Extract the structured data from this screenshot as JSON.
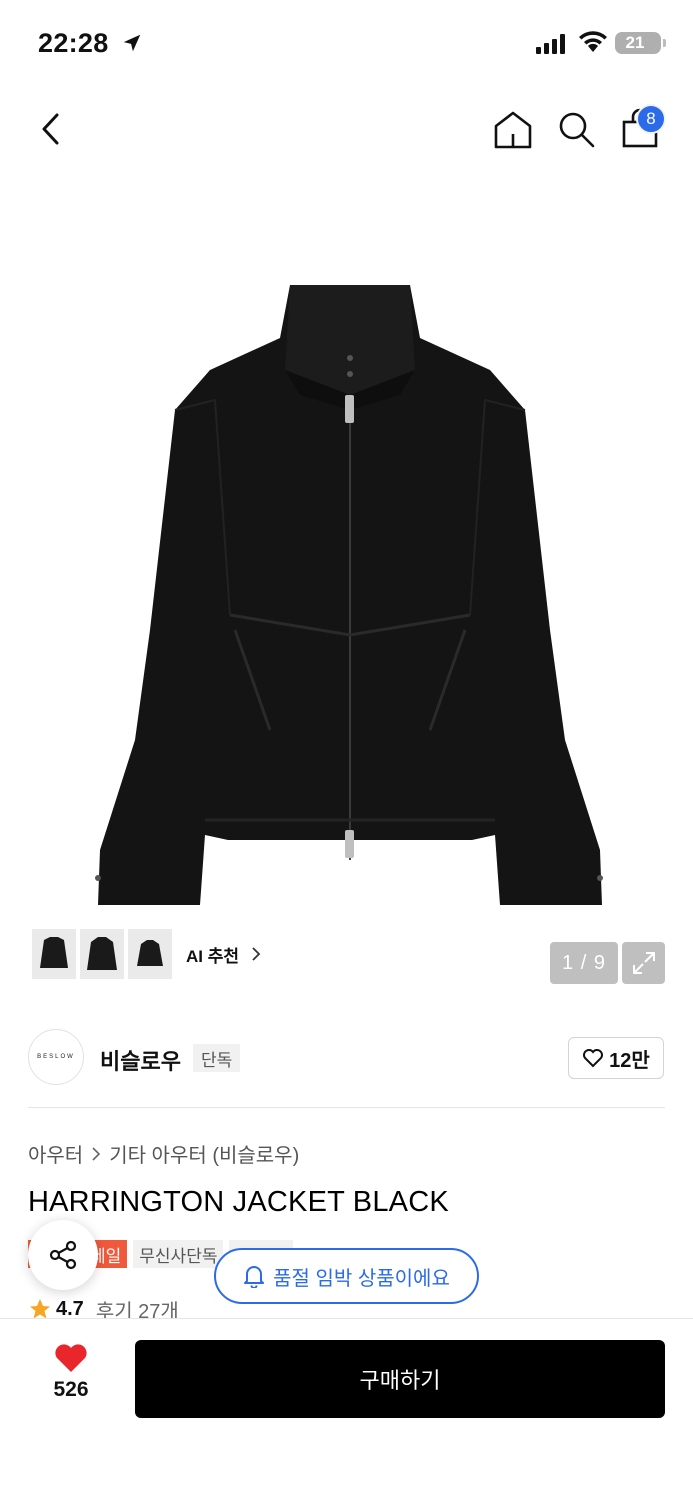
{
  "status_bar": {
    "time": "22:28",
    "battery": "21"
  },
  "nav": {
    "cart_count": "8"
  },
  "gallery": {
    "ai_label": "AI 추천",
    "page_counter": "1 / 9"
  },
  "brand": {
    "logo_text": "BESLOW",
    "name": "비슬로우",
    "tag": "단독",
    "likes": "12만"
  },
  "product": {
    "breadcrumb": [
      "아우터",
      "기타 아우터 (비슬로우)"
    ],
    "title": "HARRINGTON JACKET BLACK",
    "tags": {
      "sale": "세일",
      "exclusive": "무신사단독"
    },
    "rating": "4.7",
    "reviews": "후기 27개"
  },
  "soldout_notice": "품절 임박 상품이에요",
  "bottom": {
    "wish_count": "526",
    "buy_label": "구매하기"
  },
  "colors": {
    "accent_blue": "#2b6bea",
    "sale_red": "#f05a3c",
    "heart_red": "#e8262b"
  }
}
